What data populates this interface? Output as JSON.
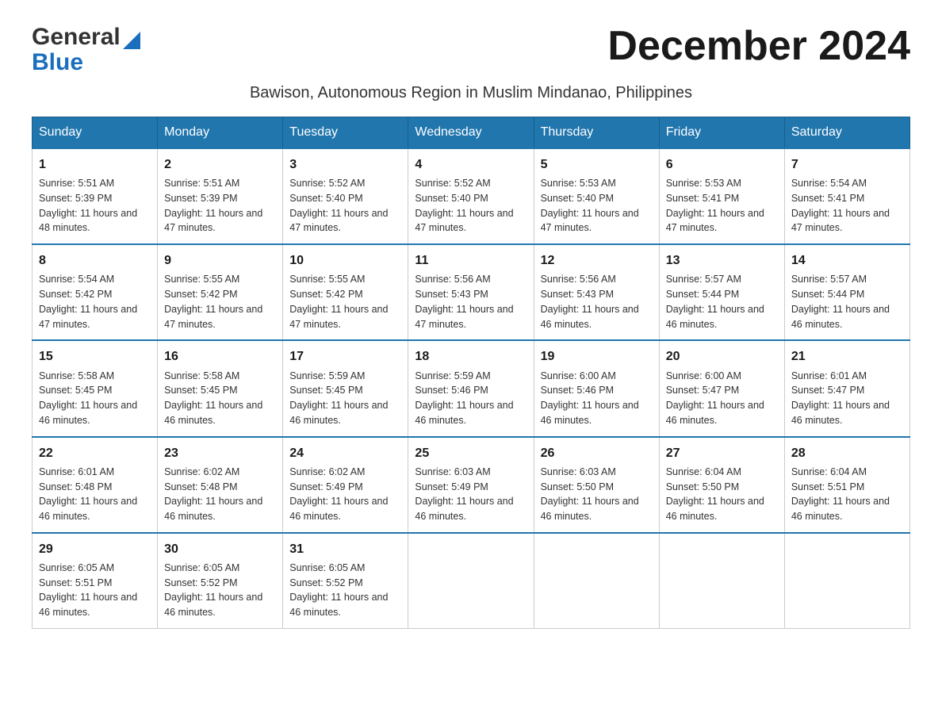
{
  "header": {
    "logo_general": "General",
    "logo_blue": "Blue",
    "title": "December 2024",
    "subtitle": "Bawison, Autonomous Region in Muslim Mindanao, Philippines"
  },
  "days_of_week": [
    "Sunday",
    "Monday",
    "Tuesday",
    "Wednesday",
    "Thursday",
    "Friday",
    "Saturday"
  ],
  "weeks": [
    [
      {
        "day": "1",
        "sunrise": "Sunrise: 5:51 AM",
        "sunset": "Sunset: 5:39 PM",
        "daylight": "Daylight: 11 hours and 48 minutes."
      },
      {
        "day": "2",
        "sunrise": "Sunrise: 5:51 AM",
        "sunset": "Sunset: 5:39 PM",
        "daylight": "Daylight: 11 hours and 47 minutes."
      },
      {
        "day": "3",
        "sunrise": "Sunrise: 5:52 AM",
        "sunset": "Sunset: 5:40 PM",
        "daylight": "Daylight: 11 hours and 47 minutes."
      },
      {
        "day": "4",
        "sunrise": "Sunrise: 5:52 AM",
        "sunset": "Sunset: 5:40 PM",
        "daylight": "Daylight: 11 hours and 47 minutes."
      },
      {
        "day": "5",
        "sunrise": "Sunrise: 5:53 AM",
        "sunset": "Sunset: 5:40 PM",
        "daylight": "Daylight: 11 hours and 47 minutes."
      },
      {
        "day": "6",
        "sunrise": "Sunrise: 5:53 AM",
        "sunset": "Sunset: 5:41 PM",
        "daylight": "Daylight: 11 hours and 47 minutes."
      },
      {
        "day": "7",
        "sunrise": "Sunrise: 5:54 AM",
        "sunset": "Sunset: 5:41 PM",
        "daylight": "Daylight: 11 hours and 47 minutes."
      }
    ],
    [
      {
        "day": "8",
        "sunrise": "Sunrise: 5:54 AM",
        "sunset": "Sunset: 5:42 PM",
        "daylight": "Daylight: 11 hours and 47 minutes."
      },
      {
        "day": "9",
        "sunrise": "Sunrise: 5:55 AM",
        "sunset": "Sunset: 5:42 PM",
        "daylight": "Daylight: 11 hours and 47 minutes."
      },
      {
        "day": "10",
        "sunrise": "Sunrise: 5:55 AM",
        "sunset": "Sunset: 5:42 PM",
        "daylight": "Daylight: 11 hours and 47 minutes."
      },
      {
        "day": "11",
        "sunrise": "Sunrise: 5:56 AM",
        "sunset": "Sunset: 5:43 PM",
        "daylight": "Daylight: 11 hours and 47 minutes."
      },
      {
        "day": "12",
        "sunrise": "Sunrise: 5:56 AM",
        "sunset": "Sunset: 5:43 PM",
        "daylight": "Daylight: 11 hours and 46 minutes."
      },
      {
        "day": "13",
        "sunrise": "Sunrise: 5:57 AM",
        "sunset": "Sunset: 5:44 PM",
        "daylight": "Daylight: 11 hours and 46 minutes."
      },
      {
        "day": "14",
        "sunrise": "Sunrise: 5:57 AM",
        "sunset": "Sunset: 5:44 PM",
        "daylight": "Daylight: 11 hours and 46 minutes."
      }
    ],
    [
      {
        "day": "15",
        "sunrise": "Sunrise: 5:58 AM",
        "sunset": "Sunset: 5:45 PM",
        "daylight": "Daylight: 11 hours and 46 minutes."
      },
      {
        "day": "16",
        "sunrise": "Sunrise: 5:58 AM",
        "sunset": "Sunset: 5:45 PM",
        "daylight": "Daylight: 11 hours and 46 minutes."
      },
      {
        "day": "17",
        "sunrise": "Sunrise: 5:59 AM",
        "sunset": "Sunset: 5:45 PM",
        "daylight": "Daylight: 11 hours and 46 minutes."
      },
      {
        "day": "18",
        "sunrise": "Sunrise: 5:59 AM",
        "sunset": "Sunset: 5:46 PM",
        "daylight": "Daylight: 11 hours and 46 minutes."
      },
      {
        "day": "19",
        "sunrise": "Sunrise: 6:00 AM",
        "sunset": "Sunset: 5:46 PM",
        "daylight": "Daylight: 11 hours and 46 minutes."
      },
      {
        "day": "20",
        "sunrise": "Sunrise: 6:00 AM",
        "sunset": "Sunset: 5:47 PM",
        "daylight": "Daylight: 11 hours and 46 minutes."
      },
      {
        "day": "21",
        "sunrise": "Sunrise: 6:01 AM",
        "sunset": "Sunset: 5:47 PM",
        "daylight": "Daylight: 11 hours and 46 minutes."
      }
    ],
    [
      {
        "day": "22",
        "sunrise": "Sunrise: 6:01 AM",
        "sunset": "Sunset: 5:48 PM",
        "daylight": "Daylight: 11 hours and 46 minutes."
      },
      {
        "day": "23",
        "sunrise": "Sunrise: 6:02 AM",
        "sunset": "Sunset: 5:48 PM",
        "daylight": "Daylight: 11 hours and 46 minutes."
      },
      {
        "day": "24",
        "sunrise": "Sunrise: 6:02 AM",
        "sunset": "Sunset: 5:49 PM",
        "daylight": "Daylight: 11 hours and 46 minutes."
      },
      {
        "day": "25",
        "sunrise": "Sunrise: 6:03 AM",
        "sunset": "Sunset: 5:49 PM",
        "daylight": "Daylight: 11 hours and 46 minutes."
      },
      {
        "day": "26",
        "sunrise": "Sunrise: 6:03 AM",
        "sunset": "Sunset: 5:50 PM",
        "daylight": "Daylight: 11 hours and 46 minutes."
      },
      {
        "day": "27",
        "sunrise": "Sunrise: 6:04 AM",
        "sunset": "Sunset: 5:50 PM",
        "daylight": "Daylight: 11 hours and 46 minutes."
      },
      {
        "day": "28",
        "sunrise": "Sunrise: 6:04 AM",
        "sunset": "Sunset: 5:51 PM",
        "daylight": "Daylight: 11 hours and 46 minutes."
      }
    ],
    [
      {
        "day": "29",
        "sunrise": "Sunrise: 6:05 AM",
        "sunset": "Sunset: 5:51 PM",
        "daylight": "Daylight: 11 hours and 46 minutes."
      },
      {
        "day": "30",
        "sunrise": "Sunrise: 6:05 AM",
        "sunset": "Sunset: 5:52 PM",
        "daylight": "Daylight: 11 hours and 46 minutes."
      },
      {
        "day": "31",
        "sunrise": "Sunrise: 6:05 AM",
        "sunset": "Sunset: 5:52 PM",
        "daylight": "Daylight: 11 hours and 46 minutes."
      },
      null,
      null,
      null,
      null
    ]
  ]
}
